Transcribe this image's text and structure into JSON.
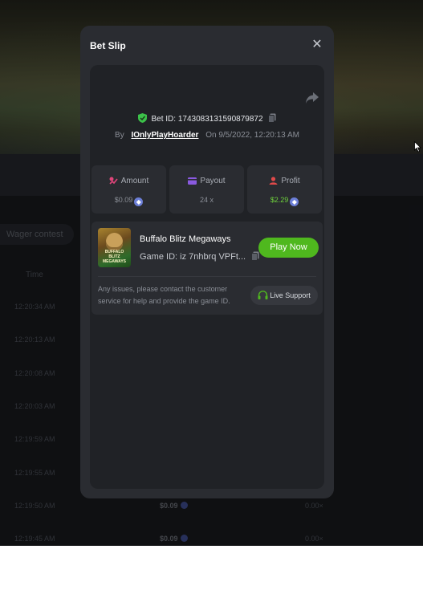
{
  "background": {
    "filter_chip": "Wager contest",
    "column_time": "Time",
    "rows": [
      {
        "time": "12:20:34 AM",
        "amount": "",
        "multiplier": ""
      },
      {
        "time": "12:20:13 AM",
        "amount": "",
        "multiplier": ""
      },
      {
        "time": "12:20:08 AM",
        "amount": "",
        "multiplier": ""
      },
      {
        "time": "12:20:03 AM",
        "amount": "",
        "multiplier": ""
      },
      {
        "time": "12:19:59 AM",
        "amount": "",
        "multiplier": ""
      },
      {
        "time": "12:19:55 AM",
        "amount": "",
        "multiplier": ""
      },
      {
        "time": "12:19:50 AM",
        "amount": "$0.09",
        "multiplier": "0.00×"
      },
      {
        "time": "12:19:45 AM",
        "amount": "$0.09",
        "multiplier": "0.00×"
      }
    ]
  },
  "modal": {
    "title": "Bet Slip",
    "close_icon": "close-icon",
    "share_icon": "share-icon",
    "bet_id_label": "Bet ID:",
    "bet_id": "174308313159087987​2",
    "by_label": "By",
    "username": "IOnlyPlayHoarder",
    "on_label": "On",
    "datetime": "9/5/2022, 12:20:13 AM",
    "stats": {
      "amount": {
        "label": "Amount",
        "value": "$0.09",
        "icon": "wallet-icon",
        "currency_icon": "eth-icon"
      },
      "payout": {
        "label": "Payout",
        "value": "24 x",
        "icon": "card-icon"
      },
      "profit": {
        "label": "Profit",
        "value": "$2.29",
        "icon": "user-icon",
        "currency_icon": "eth-icon"
      }
    },
    "game": {
      "name": "Buffalo Blitz Megaways",
      "game_id_label": "Game ID:",
      "game_id": "iz 7nhbrq VPFt...",
      "thumb_text": "BUFFALO BLITZ MEGAWAYS",
      "play_label": "Play Now"
    },
    "help_text": "Any issues, please contact the customer service for help and provide the game ID.",
    "support_label": "Live Support"
  },
  "colors": {
    "accent_green": "#4fb81e",
    "profit_green": "#6fd23c",
    "modal_bg": "#2a2c31",
    "card_bg": "#202226"
  }
}
